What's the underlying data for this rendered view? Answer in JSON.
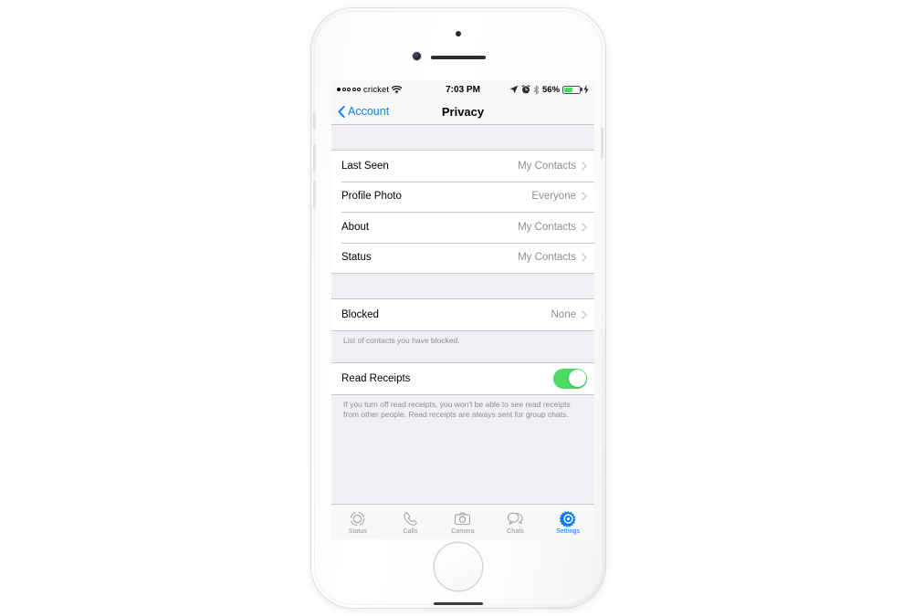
{
  "device": {
    "name": "iphone-silver"
  },
  "status_bar": {
    "signal_dots_filled": 1,
    "signal_dots_total": 5,
    "carrier": "cricket",
    "wifi_icon": "wifi-icon",
    "time": "7:03 PM",
    "location_icon": "location-arrow-icon",
    "alarm_icon": "alarm-clock-icon",
    "bluetooth_icon": "bluetooth-icon",
    "battery_percent": "56%",
    "battery_level": 56,
    "charging_icon": "lightning-bolt-icon",
    "battery_color": "#4cd964"
  },
  "nav": {
    "back_label": "Account",
    "back_icon": "chevron-left-icon",
    "title": "Privacy",
    "tint": "#0a7cff"
  },
  "sections": [
    {
      "name": "visibility",
      "rows": [
        {
          "label": "Last Seen",
          "value": "My Contacts",
          "accessory": "chevron-right-icon"
        },
        {
          "label": "Profile Photo",
          "value": "Everyone",
          "accessory": "chevron-right-icon"
        },
        {
          "label": "About",
          "value": "My Contacts",
          "accessory": "chevron-right-icon"
        },
        {
          "label": "Status",
          "value": "My Contacts",
          "accessory": "chevron-right-icon"
        }
      ]
    },
    {
      "name": "blocked",
      "rows": [
        {
          "label": "Blocked",
          "value": "None",
          "accessory": "chevron-right-icon"
        }
      ],
      "footer": "List of contacts you have blocked."
    },
    {
      "name": "read-receipts",
      "rows": [
        {
          "label": "Read Receipts",
          "value": "",
          "accessory": "toggle-switch",
          "toggle_on": true
        }
      ],
      "footer": "If you turn off read receipts, you won't be able to see read receipts from other people. Read receipts are always sent for group chats."
    }
  ],
  "tabbar": {
    "active_index": 4,
    "active_color": "#0a7cff",
    "inactive_color": "#929292",
    "tabs": [
      {
        "label": "Status",
        "icon": "status-ring-icon"
      },
      {
        "label": "Calls",
        "icon": "phone-handset-icon"
      },
      {
        "label": "Camera",
        "icon": "camera-icon"
      },
      {
        "label": "Chats",
        "icon": "chat-bubbles-icon"
      },
      {
        "label": "Settings",
        "icon": "gear-icon"
      }
    ]
  }
}
